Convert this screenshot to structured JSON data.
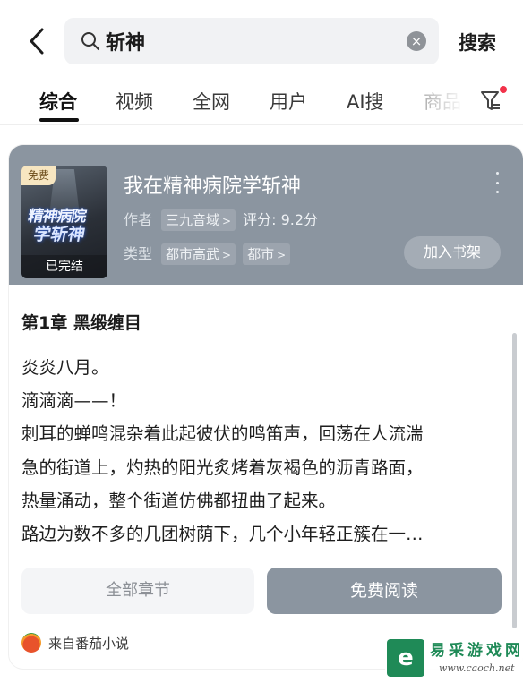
{
  "search": {
    "query": "斩神",
    "submit_label": "搜索"
  },
  "tabs": [
    {
      "label": "综合",
      "active": true
    },
    {
      "label": "视频"
    },
    {
      "label": "全网"
    },
    {
      "label": "用户"
    },
    {
      "label": "AI搜"
    },
    {
      "label": "商品"
    }
  ],
  "book": {
    "free_badge": "免费",
    "cover_title_line1": "精神病院",
    "cover_title_line2": "学斩神",
    "status": "已完结",
    "title": "我在精神病院学斩神",
    "author_key": "作者",
    "author": "三九音域",
    "score_text": "评分: 9.2分",
    "genre_key": "类型",
    "genres": [
      "都市高武",
      "都市"
    ],
    "add_shelf_label": "加入书架"
  },
  "excerpt": {
    "chapter_title": "第1章 黑缎缠目",
    "lines": [
      "炎炎八月。",
      "滴滴滴——！",
      "刺耳的蝉鸣混杂着此起彼伏的鸣笛声，回荡在人流湍",
      "急的街道上，灼热的阳光炙烤着灰褐色的沥青路面，",
      "热量涌动，整个街道仿佛都扭曲了起来。",
      "路边为数不多的几团树荫下，几个小年轻正簇在一…"
    ]
  },
  "actions": {
    "all_chapters": "全部章节",
    "free_read": "免费阅读"
  },
  "source": {
    "label": "来自番茄小说"
  },
  "watermark": {
    "title": "易采游戏网",
    "url": "www.caoch.net"
  },
  "colors": {
    "card_header": "#8b95a0",
    "primary_button": "#8b95a0",
    "filter_dot": "#f2324a",
    "watermark_green": "#1f8a57"
  }
}
